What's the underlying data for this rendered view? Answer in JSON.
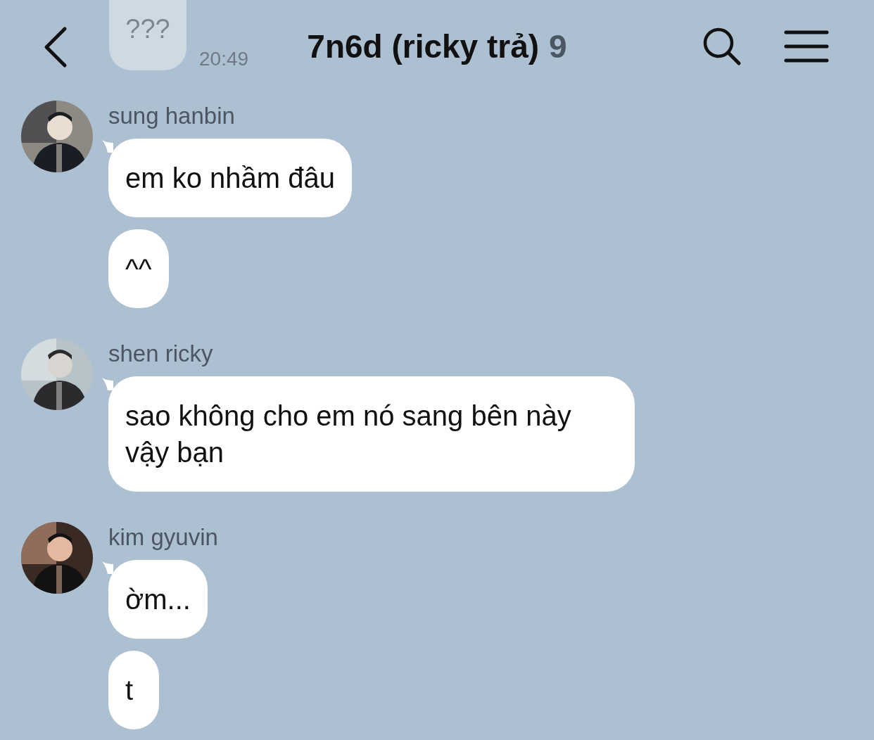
{
  "header": {
    "title": "7n6d (ricky trả)",
    "member_count": "9"
  },
  "faded_message": {
    "text": "???",
    "time": "20:49"
  },
  "groups": [
    {
      "sender": "sung hanbin",
      "avatar": {
        "kind": "picture"
      },
      "messages": [
        "em ko nhầm đâu",
        "^^"
      ]
    },
    {
      "sender": "shen ricky",
      "avatar": {
        "kind": "picture"
      },
      "messages": [
        "sao không cho em nó sang bên này vậy bạn"
      ]
    },
    {
      "sender": "kim gyuvin",
      "avatar": {
        "kind": "picture"
      },
      "messages": [
        "ờm...",
        "t"
      ]
    }
  ]
}
